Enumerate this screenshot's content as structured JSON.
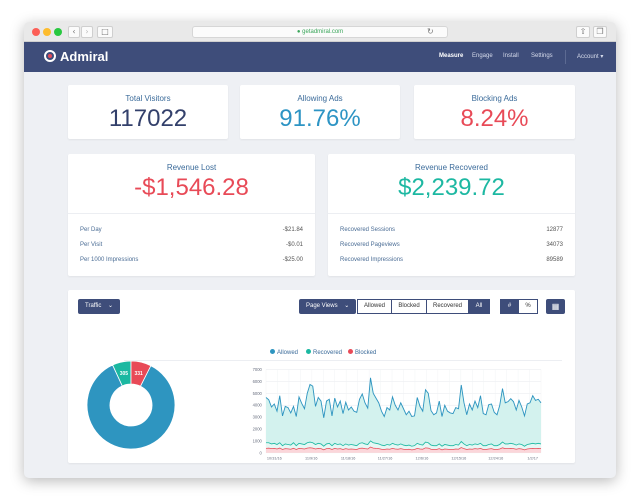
{
  "browser": {
    "url": "getadmiral.com"
  },
  "app": {
    "name": "Admiral"
  },
  "nav": {
    "items": [
      "Measure",
      "Engage",
      "Install",
      "Settings"
    ],
    "account": "Account"
  },
  "stats": [
    {
      "label": "Total Visitors",
      "value": "117022",
      "color": "#33406b"
    },
    {
      "label": "Allowing Ads",
      "value": "91.76%",
      "color": "#2d94c4"
    },
    {
      "label": "Blocking Ads",
      "value": "8.24%",
      "color": "#e84a57"
    }
  ],
  "revenue_lost": {
    "label": "Revenue Lost",
    "value": "-$1,546.28",
    "color": "#e84a57",
    "rows": [
      {
        "label": "Per Day",
        "value": "-$21.84"
      },
      {
        "label": "Per Visit",
        "value": "-$0.01"
      },
      {
        "label": "Per 1000 Impressions",
        "value": "-$25.00"
      }
    ]
  },
  "revenue_recovered": {
    "label": "Revenue Recovered",
    "value": "$2,239.72",
    "color": "#1db8a2",
    "rows": [
      {
        "label": "Recovered Sessions",
        "value": "12877"
      },
      {
        "label": "Recovered Pageviews",
        "value": "34073"
      },
      {
        "label": "Recovered Impressions",
        "value": "89589"
      }
    ]
  },
  "controls": {
    "traffic_dropdown": "Traffic",
    "metric_dropdown": "Page Views",
    "filters": [
      "Allowed",
      "Blocked",
      "Recovered",
      "All"
    ],
    "active_filter": "All",
    "units": [
      "#",
      "%"
    ],
    "active_unit": "#"
  },
  "colors": {
    "allowed": "#2e95c0",
    "recovered": "#1bb8a1",
    "blocked": "#e84a57",
    "area_fill": "#d3f2ee"
  },
  "chart_data": [
    {
      "type": "pie",
      "variant": "donut",
      "slices": [
        {
          "name": "Allowed",
          "value": 3796
        },
        {
          "name": "Recovered",
          "value": 305
        },
        {
          "name": "Blocked",
          "value": 331
        }
      ]
    },
    {
      "type": "area",
      "legend": [
        "Allowed",
        "Recovered",
        "Blocked"
      ],
      "legend_position": "top",
      "ylim": [
        0,
        7000
      ],
      "yticks": [
        0,
        1000,
        2000,
        3000,
        4000,
        5000,
        6000,
        7000
      ],
      "xticklabels": [
        "10/31/16",
        "11/9/16",
        "11/18/16",
        "11/27/16",
        "12/6/16",
        "12/15/16",
        "12/24/16",
        "1/2/17"
      ],
      "grid": true,
      "series": [
        {
          "name": "Allowed",
          "values": [
            4650,
            4450,
            3850,
            4100,
            3500,
            4800,
            3100,
            3900,
            3800,
            3350,
            3900,
            3050,
            4700,
            4150,
            3700,
            5000,
            5750,
            5600,
            3900,
            4650,
            4350,
            2950,
            4350,
            4500,
            3100,
            4600,
            3850,
            4350,
            3300,
            4250,
            3600,
            3850,
            3500,
            3400,
            4500,
            4950,
            4200,
            3750,
            6300,
            5000,
            4600,
            4200,
            3500,
            3050,
            3800,
            3600,
            4700,
            4000,
            3600,
            4200,
            3700,
            3200,
            3500,
            3050,
            3100,
            4650,
            3900,
            3500,
            5300,
            5000,
            3550,
            3200,
            3350,
            4350,
            3050,
            4000,
            3500,
            3350,
            3300,
            3800,
            3700,
            5700,
            4200,
            3200,
            4100,
            3600,
            4350,
            3800,
            4800,
            3300,
            3200,
            4050,
            4100,
            3400,
            3200,
            4000,
            5400,
            4200,
            4300,
            4550,
            4300,
            3600,
            4400,
            3850,
            3100,
            4100,
            4200,
            4800,
            4400,
            4500,
            4200
          ]
        },
        {
          "name": "Recovered",
          "values": [
            850,
            850,
            750,
            800,
            700,
            850,
            600,
            750,
            700,
            650,
            850,
            600,
            800,
            750,
            700,
            850,
            900,
            850,
            700,
            800,
            750,
            550,
            750,
            800,
            600,
            800,
            700,
            750,
            600,
            750,
            650,
            700,
            650,
            600,
            800,
            850,
            750,
            700,
            1000,
            850,
            800,
            750,
            650,
            600,
            700,
            650,
            800,
            700,
            650,
            750,
            650,
            600,
            650,
            550,
            600,
            800,
            700,
            650,
            900,
            850,
            650,
            600,
            600,
            750,
            550,
            700,
            650,
            600,
            600,
            700,
            650,
            950,
            750,
            600,
            700,
            650,
            750,
            700,
            800,
            600,
            600,
            700,
            750,
            600,
            600,
            700,
            900,
            750,
            750,
            800,
            750,
            650,
            750,
            700,
            550,
            700,
            750,
            800,
            750,
            800,
            750
          ]
        },
        {
          "name": "Blocked",
          "values": [
            380,
            400,
            350,
            370,
            320,
            400,
            280,
            350,
            330,
            300,
            380,
            280,
            370,
            350,
            320,
            400,
            430,
            400,
            320,
            370,
            350,
            250,
            350,
            370,
            280,
            370,
            320,
            350,
            280,
            350,
            300,
            320,
            300,
            280,
            370,
            400,
            350,
            320,
            480,
            400,
            370,
            350,
            300,
            280,
            320,
            300,
            370,
            320,
            300,
            350,
            300,
            280,
            300,
            250,
            280,
            370,
            320,
            300,
            420,
            400,
            300,
            280,
            280,
            350,
            250,
            320,
            300,
            280,
            280,
            320,
            300,
            450,
            350,
            280,
            320,
            300,
            350,
            320,
            370,
            280,
            280,
            320,
            350,
            280,
            280,
            320,
            420,
            350,
            350,
            370,
            350,
            300,
            350,
            320,
            250,
            320,
            350,
            370,
            350,
            370,
            350
          ]
        }
      ]
    }
  ]
}
